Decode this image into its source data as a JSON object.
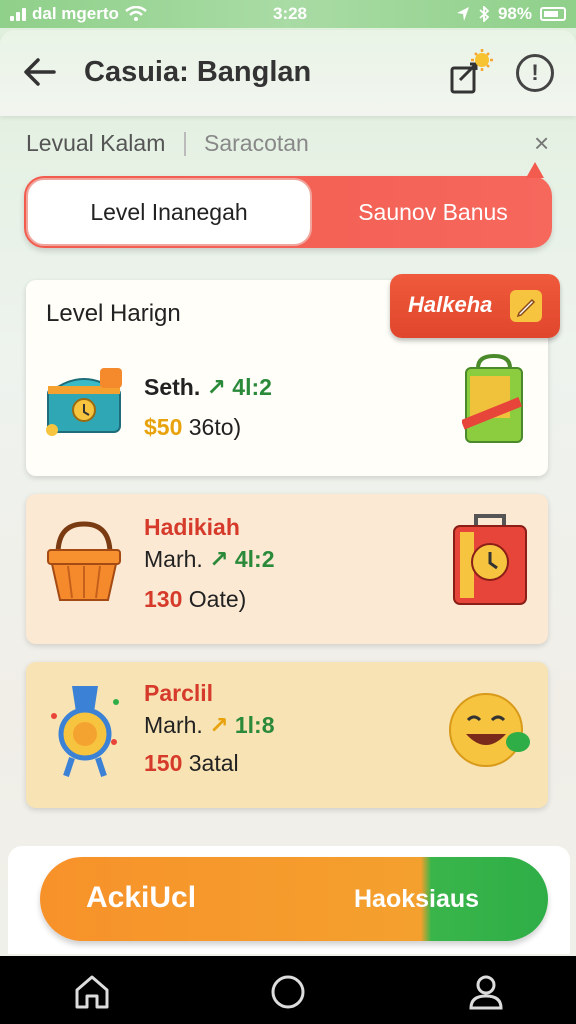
{
  "status_bar": {
    "carrier": "dal mgerto",
    "time": "3:28",
    "battery": "98%",
    "icons": [
      "signal-icon",
      "wifi-icon",
      "location-icon",
      "bluetooth-icon",
      "battery-icon"
    ]
  },
  "header": {
    "title": "Casuia: Banglan",
    "icons": [
      "back-arrow-icon",
      "share-icon",
      "info-icon"
    ],
    "info_glyph": "!"
  },
  "breadcrumb": {
    "active": "Levual Kalam",
    "other": "Saracotan",
    "close": "×"
  },
  "toggle": {
    "left_label": "Level Inanegah",
    "right_label": "Saunov Banus"
  },
  "featured": {
    "title": "Level Harign",
    "badge_label": "Halkeha",
    "badge_icon": "pencil-icon",
    "item": {
      "name": "Seth.",
      "level": "4l:2",
      "price": "$50",
      "price_suffix": "36to)",
      "icon": "treasure-chest-icon",
      "side_icon": "gift-bag-icon"
    }
  },
  "items": [
    {
      "name": "Hadikiah",
      "name_prefix": "Marh.",
      "level": "4l:2",
      "price": "130",
      "price_suffix": "Oate)",
      "icon": "basket-icon",
      "side_icon": "clock-suitcase-icon"
    },
    {
      "name": "Parclil",
      "name_prefix": "Marh.",
      "level": "1l:8",
      "price": "150",
      "price_suffix": "3atal",
      "icon": "medal-icon",
      "side_icon": "emoji-icon"
    }
  ],
  "action": {
    "left_label": "AckiUcl",
    "right_label": "Haoksiaus"
  },
  "nav": [
    "home-icon",
    "circle-home-icon",
    "profile-icon"
  ],
  "colors": {
    "accent_red": "#f25b4e",
    "orange": "#f7922a",
    "green": "#2fae47",
    "price_gold": "#e8a20c",
    "name_red": "#d63a2a"
  }
}
